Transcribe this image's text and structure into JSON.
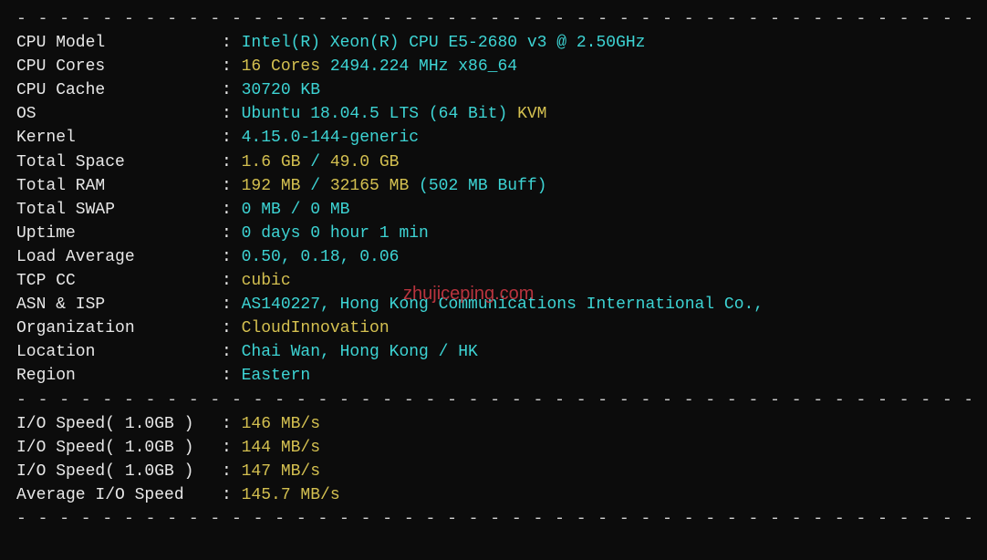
{
  "divider": "- - - - - - - - - - - - - - - - - - - - - - - - - - - - - - - - - - - - - - - - - - - - - - - - - - - - - -",
  "sysinfo": {
    "cpu_model": {
      "label": "CPU Model",
      "value": "Intel(R) Xeon(R) CPU E5-2680 v3 @ 2.50GHz"
    },
    "cpu_cores": {
      "label": "CPU Cores",
      "cores": "16 Cores",
      "freq": " 2494.224 MHz x86_64"
    },
    "cpu_cache": {
      "label": "CPU Cache",
      "value": "30720 KB"
    },
    "os": {
      "label": "OS",
      "name": "Ubuntu 18.04.5 LTS (64 Bit)",
      "virt": " KVM"
    },
    "kernel": {
      "label": "Kernel",
      "value": "4.15.0-144-generic"
    },
    "total_space": {
      "label": "Total Space",
      "used": "1.6 GB",
      "sep": " / ",
      "total": "49.0 GB"
    },
    "total_ram": {
      "label": "Total RAM",
      "used": "192 MB",
      "sep": " / ",
      "total": "32165 MB",
      "buff": " (502 MB Buff)"
    },
    "total_swap": {
      "label": "Total SWAP",
      "used": "0 MB",
      "sep": " / ",
      "total": "0 MB"
    },
    "uptime": {
      "label": "Uptime",
      "value": "0 days 0 hour 1 min"
    },
    "load_avg": {
      "label": "Load Average",
      "value": "0.50, 0.18, 0.06"
    },
    "tcp_cc": {
      "label": "TCP CC",
      "value": "cubic"
    },
    "asn_isp": {
      "label": "ASN & ISP",
      "value": "AS140227, Hong Kong Communications International Co.,"
    },
    "organization": {
      "label": "Organization",
      "value": "CloudInnovation"
    },
    "location": {
      "label": "Location",
      "value": "Chai Wan, Hong Kong / HK"
    },
    "region": {
      "label": "Region",
      "value": "Eastern"
    }
  },
  "io": {
    "speed1": {
      "label": "I/O Speed( 1.0GB )",
      "value": "146 MB/s"
    },
    "speed2": {
      "label": "I/O Speed( 1.0GB )",
      "value": "144 MB/s"
    },
    "speed3": {
      "label": "I/O Speed( 1.0GB )",
      "value": "147 MB/s"
    },
    "avg": {
      "label": "Average I/O Speed",
      "value": "145.7 MB/s"
    }
  },
  "watermark": "zhujiceping.com"
}
